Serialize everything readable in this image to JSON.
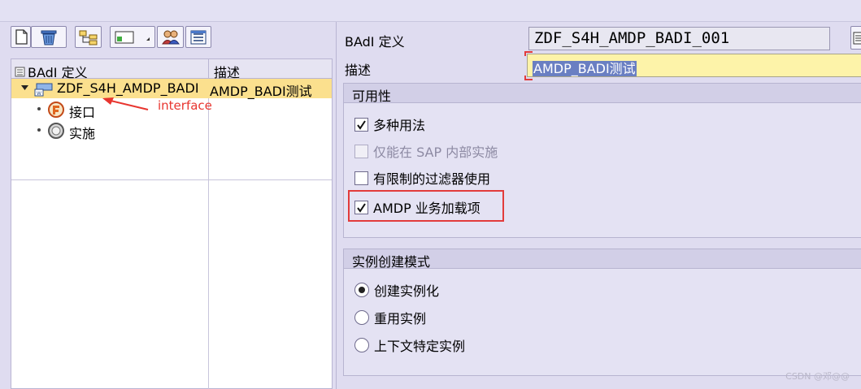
{
  "tree": {
    "col1_header": "BAdI 定义",
    "col2_header": "描述",
    "root_name": "ZDF_S4H_AMDP_BADI",
    "root_desc": "AMDP_BADI测试",
    "child1_label": "接口",
    "child2_label": "实施"
  },
  "annotation": {
    "text": "interface",
    "color": "#e8352f"
  },
  "header": {
    "badi_label": "BAdI 定义",
    "badi_value": "ZDF_S4H_AMDP_BADI_001",
    "desc_label": "描述",
    "desc_value": "AMDP_BADI测试"
  },
  "usability": {
    "title": "可用性",
    "options": [
      {
        "label": "多种用法",
        "checked": true,
        "enabled": true
      },
      {
        "label": "仅能在 SAP 内部实施",
        "checked": false,
        "enabled": false
      },
      {
        "label": "有限制的过滤器使用",
        "checked": false,
        "enabled": true
      },
      {
        "label": "AMDP 业务加载项",
        "checked": true,
        "enabled": true
      }
    ]
  },
  "instance": {
    "title": "实例创建模式",
    "options": [
      {
        "label": "创建实例化",
        "selected": true
      },
      {
        "label": "重用实例",
        "selected": false
      },
      {
        "label": "上下文特定实例",
        "selected": false
      }
    ]
  },
  "toolbar_icons": [
    "new-document-icon",
    "delete-trash-icon",
    "hierarchy-icon",
    "create-element-icon",
    "users-icon",
    "details-list-icon"
  ],
  "watermark": "CSDN @邓@@",
  "colors": {
    "selection": "#fbe08e",
    "highlight": "#e23b3b",
    "edit_field": "#fdf3a9"
  }
}
